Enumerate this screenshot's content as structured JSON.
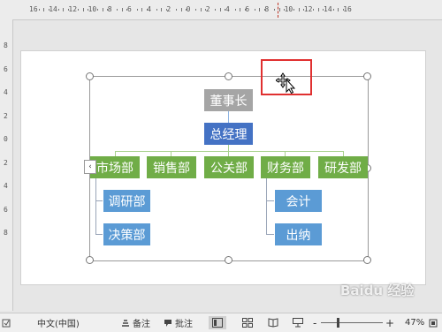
{
  "ruler": {
    "top_labels": [
      "16",
      "14",
      "12",
      "10",
      "8",
      "6",
      "4",
      "2",
      "0",
      "2",
      "4",
      "6",
      "8",
      "10",
      "12",
      "14",
      "16"
    ],
    "left_labels": [
      "8",
      "6",
      "4",
      "2",
      "0",
      "2",
      "4",
      "6",
      "8"
    ]
  },
  "org_chart": {
    "root": "董事长",
    "manager": "总经理",
    "departments": [
      "市场部",
      "销售部",
      "公关部",
      "财务部",
      "研发部"
    ],
    "market_children": [
      "调研部",
      "决策部"
    ],
    "finance_children": [
      "会计",
      "出纳"
    ]
  },
  "colors": {
    "root": "#a5a5a5",
    "manager": "#4472c4",
    "department": "#70ad47",
    "child": "#5b9bd5",
    "highlight": "#e03030"
  },
  "statusbar": {
    "language": "中文(中国)",
    "notes_label": "备注",
    "comments_label": "批注",
    "zoom_minus": "-",
    "zoom_plus": "+",
    "zoom_level": "47%"
  },
  "watermark": "Baidu 经验",
  "icons": [
    "collapse-arrow-icon",
    "move-cursor-icon",
    "notes-icon",
    "comments-icon",
    "normal-view-icon",
    "slide-sorter-icon",
    "reading-view-icon",
    "slideshow-icon",
    "fit-slide-icon"
  ]
}
